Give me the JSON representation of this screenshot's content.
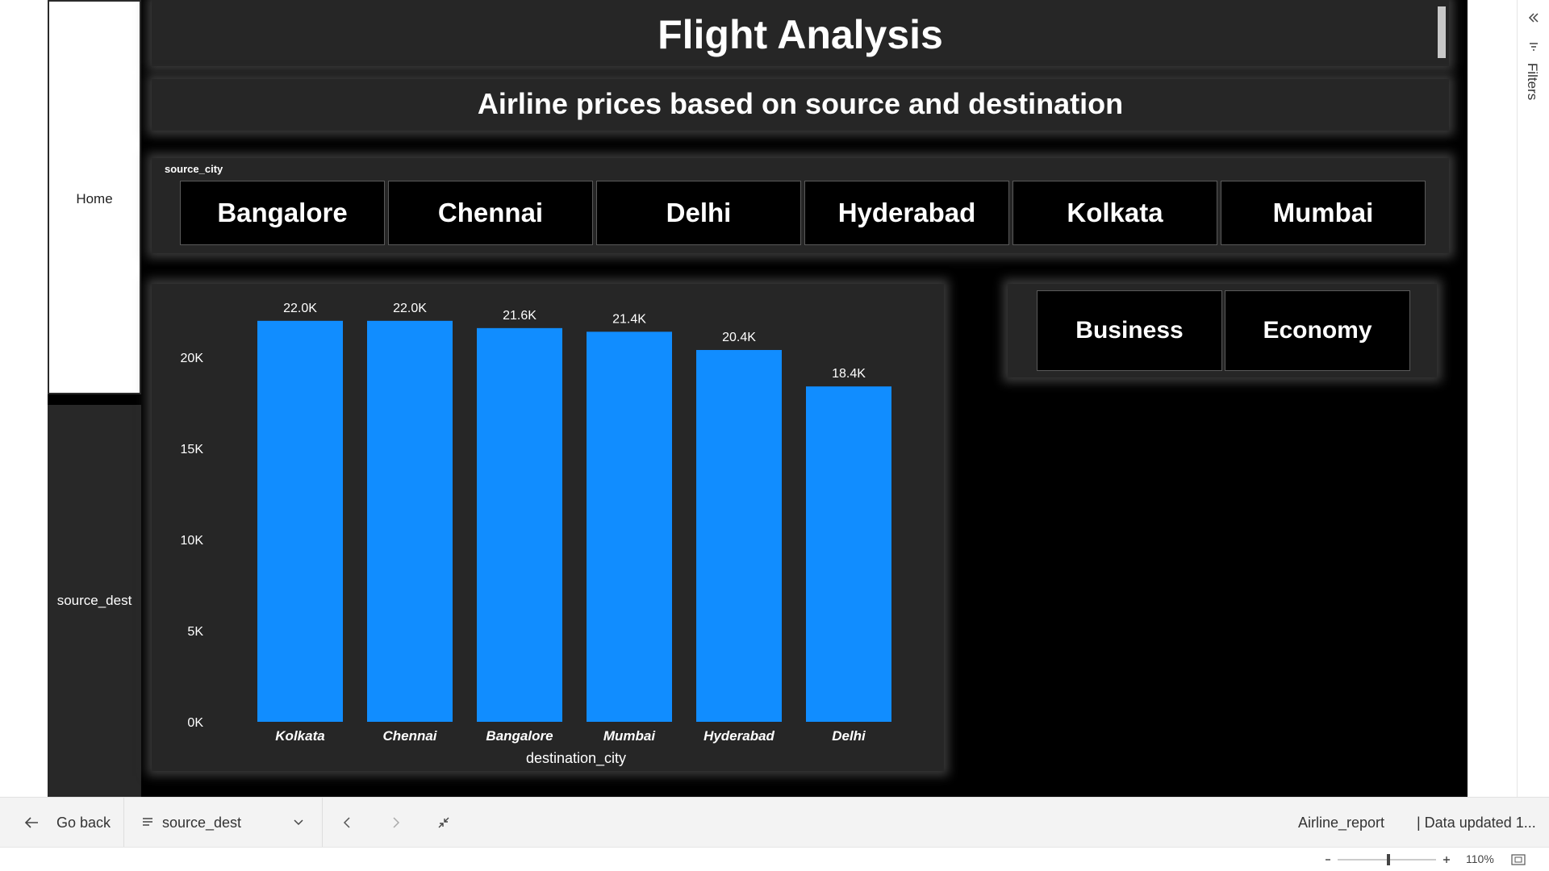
{
  "nav": {
    "home": "Home",
    "page": "source_dest"
  },
  "header": {
    "title": "Flight Analysis",
    "subtitle": "Airline prices based on source and destination"
  },
  "slicer": {
    "label": "source_city",
    "cities": [
      "Bangalore",
      "Chennai",
      "Delhi",
      "Hyderabad",
      "Kolkata",
      "Mumbai"
    ]
  },
  "class_slicer": {
    "options": [
      "Business",
      "Economy"
    ]
  },
  "chart_data": {
    "type": "bar",
    "categories": [
      "Kolkata",
      "Chennai",
      "Bangalore",
      "Mumbai",
      "Hyderabad",
      "Delhi"
    ],
    "values": [
      22000,
      22000,
      21600,
      21400,
      20400,
      18400
    ],
    "data_labels": [
      "22.0K",
      "22.0K",
      "21.6K",
      "21.4K",
      "20.4K",
      "18.4K"
    ],
    "xlabel": "destination_city",
    "ylabel": "",
    "ylim": [
      0,
      22000
    ],
    "yticks": [
      0,
      5000,
      10000,
      15000,
      20000
    ],
    "ytick_labels": [
      "0K",
      "5K",
      "10K",
      "15K",
      "20K"
    ],
    "bar_color": "#118DFF",
    "grid": false
  },
  "bottom_bar": {
    "go_back": "Go back",
    "page_select": "source_dest",
    "report_name": "Airline_report",
    "data_updated": "| Data updated 1..."
  },
  "status": {
    "zoom": "110%"
  },
  "filters_pane": {
    "label": "Filters"
  },
  "colors": {
    "canvas": "#000000",
    "panel": "#262626",
    "accent": "#118DFF"
  }
}
